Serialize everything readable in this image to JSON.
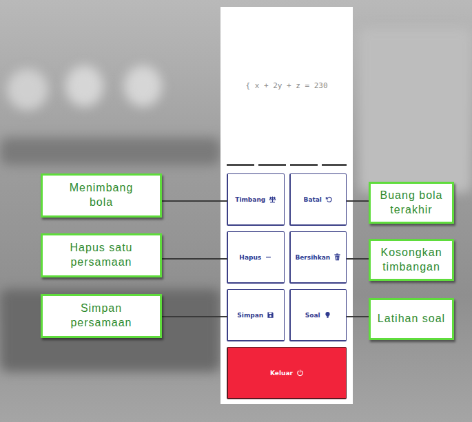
{
  "equation": "{ x + 2y + z = 230",
  "buttons": [
    {
      "label": "Timbang",
      "kind": "weigh",
      "callout": "Menimbang bola"
    },
    {
      "label": "Batal",
      "kind": "undo",
      "callout": "Buang bola terakhir"
    },
    {
      "label": "Hapus",
      "kind": "minus",
      "callout": "Hapus satu persamaan"
    },
    {
      "label": "Bersihkan",
      "kind": "trash",
      "callout": "Kosongkan timbangan"
    },
    {
      "label": "Simpan",
      "kind": "save",
      "callout": "Simpan persamaan"
    },
    {
      "label": "Soal",
      "kind": "hint",
      "callout": "Latihan soal"
    }
  ],
  "exit": {
    "label": "Keluar",
    "kind": "power"
  }
}
